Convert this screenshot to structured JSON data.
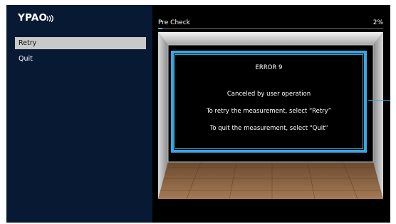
{
  "app": {
    "logo_text": "YPAO"
  },
  "menu": {
    "items": [
      {
        "label": "Retry",
        "selected": true
      },
      {
        "label": "Quit",
        "selected": false
      }
    ]
  },
  "progress": {
    "title": "Pre Check",
    "percent_text": "2%",
    "fraction": 0.02
  },
  "dialog": {
    "error_code": "ERROR 9",
    "message": "Canceled by user operation",
    "retry_hint": "To retry the measurement, select “Retry”",
    "quit_hint": "To quit the measurement, select \"Quit\""
  },
  "colors": {
    "sidebar": "#081a33",
    "highlight": "#39a7de",
    "progress": "#22c4c4",
    "selected_item": "#c9c9c9"
  }
}
